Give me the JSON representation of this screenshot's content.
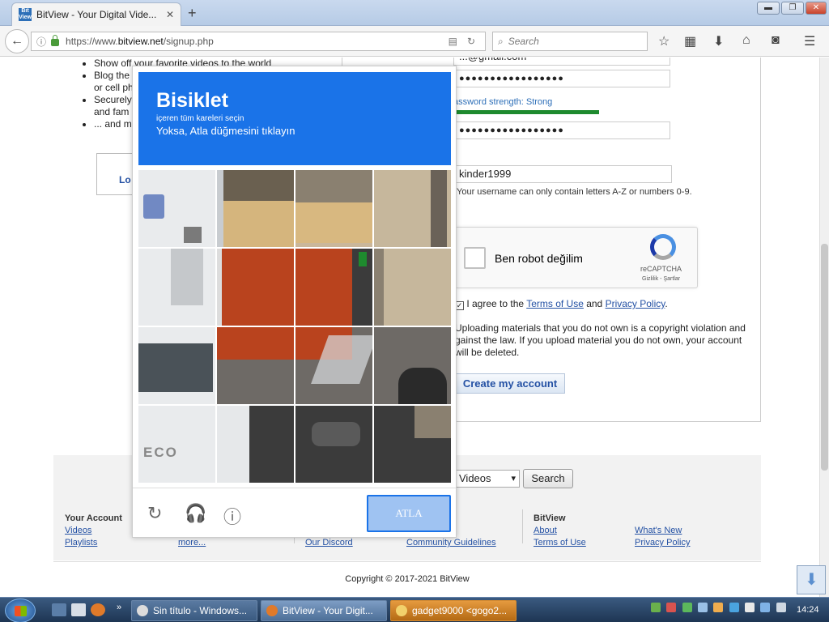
{
  "browser": {
    "tab_title": "BitView - Your Digital Vide...",
    "tab_favicon": "Bit\nView",
    "url_prefix": "https://www.",
    "url_domain": "bitview.net",
    "url_path": "/signup.php",
    "search_placeholder": "Search"
  },
  "page": {
    "features": [
      "Show off your favorite videos to the world",
      "Blog the",
      "or cell ph",
      "Securely",
      "and fam",
      "... and m"
    ],
    "login_label": "Lo",
    "email_partial": "...@gmail.com",
    "password_masked": "●●●●●●●●●●●●●●●●●",
    "password_strength": "assword strength: Strong",
    "confirm_masked": "●●●●●●●●●●●●●●●●●",
    "username_value": "kinder1999",
    "username_hint": "Your username can only contain letters A-Z or numbers 0-9.",
    "recaptcha": {
      "label": "Ben robot değilim",
      "brand": "reCAPTCHA",
      "links": "Gizlilik - Şartlar"
    },
    "agree_prefix": "I agree to the ",
    "agree_terms": "Terms of Use",
    "agree_and": " and ",
    "agree_privacy": "Privacy Policy",
    "agree_suffix": ".",
    "warning": "Uploading materials that you do not own is a copyright violation and against the law. If you upload material you do not own, your account will be deleted.",
    "warning_visible": "Uploading materials that you do not own is a copyright violation and\ngainst the law. If you upload material you do not own, your account\nwill be deleted.",
    "create_button": "Create my account",
    "search_select": "Videos",
    "search_button": "Search",
    "footer": {
      "your_account": "Your Account",
      "videos": "Videos",
      "playlists": "Playlists",
      "more": "more...",
      "our_discord": "Our Discord",
      "community_guidelines": "Community Guidelines",
      "bitview_heading": "BitView",
      "about": "About",
      "terms": "Terms of Use",
      "whats_new": "What's New",
      "privacy": "Privacy Policy"
    },
    "copyright": "Copyright © 2017-2021 BitView"
  },
  "challenge": {
    "title": "Bisiklet",
    "subtitle1": "içeren tüm kareleri seçin",
    "subtitle2": "Yoksa, Atla düğmesini tıklayın",
    "skip_button": "ATLA",
    "tile_text": "ECO"
  },
  "taskbar": {
    "items": [
      "Sin título - Windows...",
      "BitView - Your Digit...",
      "gadget9000 <gogo2..."
    ],
    "clock": "14:24"
  },
  "colors": {
    "challenge_header": "#1a73e8",
    "link": "#2451a4",
    "strength_bar": "#1e8a2e"
  }
}
